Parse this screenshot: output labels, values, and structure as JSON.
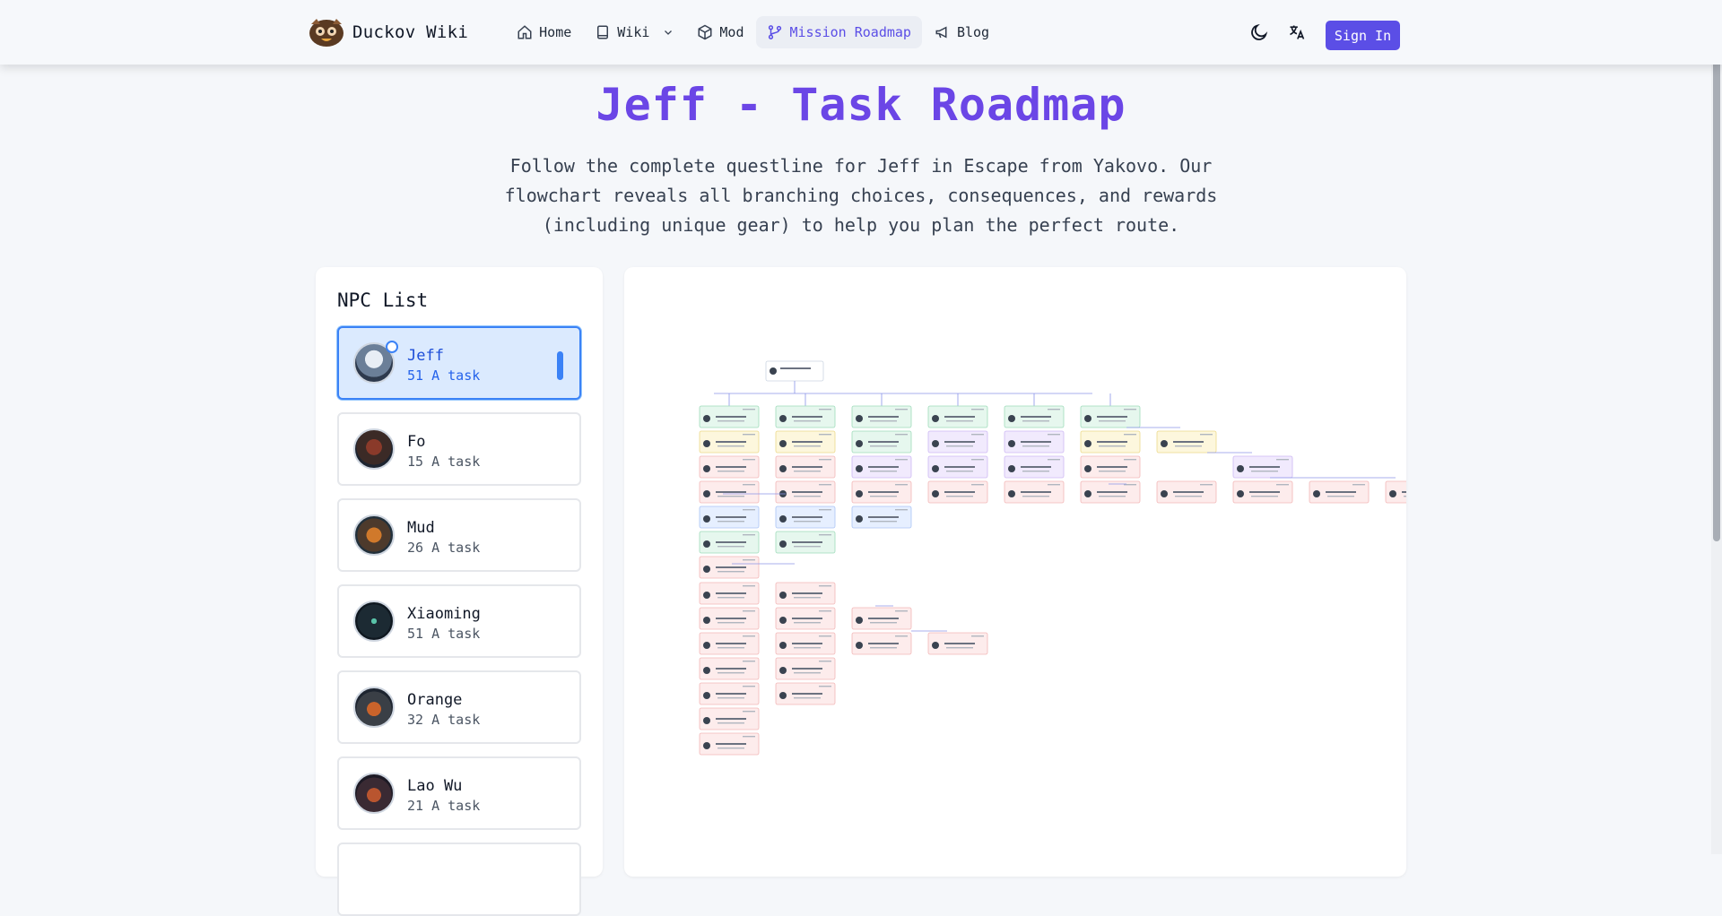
{
  "brand": {
    "name": "Duckov Wiki"
  },
  "nav": {
    "items": [
      {
        "label": "Home",
        "icon": "home-icon"
      },
      {
        "label": "Wiki",
        "icon": "book-icon"
      },
      {
        "label": "Mod",
        "icon": "cube-icon"
      },
      {
        "label": "Mission Roadmap",
        "icon": "branch-icon",
        "active": true
      },
      {
        "label": "Blog",
        "icon": "megaphone-icon"
      }
    ],
    "sign_in": "Sign In"
  },
  "page": {
    "title": "Jeff - Task Roadmap",
    "subtitle": "Follow the complete questline for Jeff in Escape from Yakovo. Our flowchart reveals all branching choices, consequences, and rewards (including unique gear) to help you plan the perfect route."
  },
  "npc_list": {
    "heading": "NPC List",
    "items": [
      {
        "name": "Jeff",
        "count": "51 A task",
        "selected": true
      },
      {
        "name": "Fo",
        "count": "15 A task"
      },
      {
        "name": "Mud",
        "count": "26 A task"
      },
      {
        "name": "Xiaoming",
        "count": "51 A task"
      },
      {
        "name": "Orange",
        "count": "32 A task"
      },
      {
        "name": "Lao Wu",
        "count": "21 A task"
      }
    ]
  },
  "colors": {
    "accent": "#5b4ee6",
    "title": "#6b46e6",
    "node_green": "#e6f7ee",
    "node_yellow": "#fdf7dd",
    "node_red": "#fdecec",
    "node_purple": "#f1eafd",
    "node_blue": "#e6efff"
  }
}
